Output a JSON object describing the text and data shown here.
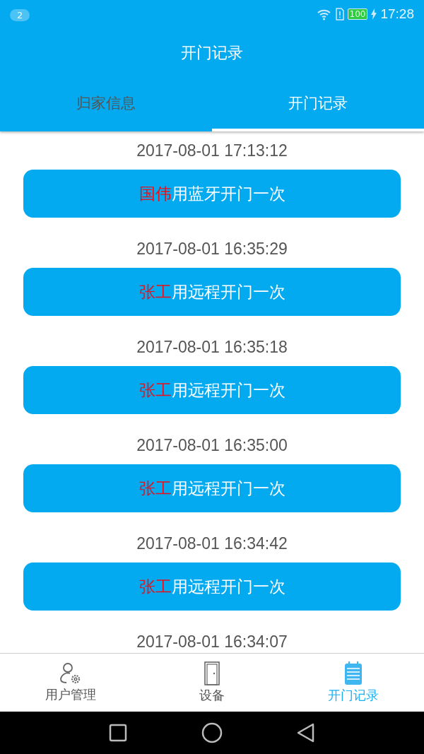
{
  "status_bar": {
    "notification_count": "2",
    "battery": "100",
    "time": "17:28"
  },
  "title": "开门记录",
  "tabs": [
    {
      "label": "归家信息",
      "selected": false
    },
    {
      "label": "开门记录",
      "selected": true
    }
  ],
  "records": [
    {
      "time": "2017-08-01 17:13:12",
      "person": "国伟",
      "action": "用蓝牙开门一次"
    },
    {
      "time": "2017-08-01 16:35:29",
      "person": "张工",
      "action": "用远程开门一次"
    },
    {
      "time": "2017-08-01 16:35:18",
      "person": "张工",
      "action": "用远程开门一次"
    },
    {
      "time": "2017-08-01 16:35:00",
      "person": "张工",
      "action": "用远程开门一次"
    },
    {
      "time": "2017-08-01 16:34:42",
      "person": "张工",
      "action": "用远程开门一次"
    },
    {
      "time": "2017-08-01 16:34:07"
    }
  ],
  "bottom_nav": [
    {
      "kind": "user",
      "label": "用户管理",
      "selected": false
    },
    {
      "kind": "door",
      "label": "设备",
      "selected": false
    },
    {
      "kind": "log",
      "label": "开门记录",
      "selected": true
    }
  ]
}
